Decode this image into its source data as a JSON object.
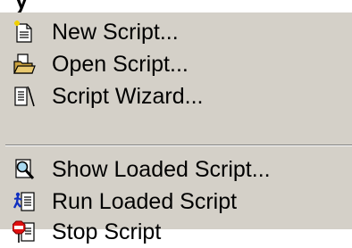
{
  "menu": {
    "items": [
      {
        "label": "New Script...",
        "icon": "new-script-icon"
      },
      {
        "label": "Open Script...",
        "icon": "open-script-icon"
      },
      {
        "label": "Script Wizard...",
        "icon": "script-wizard-icon"
      },
      {
        "label": "Show Loaded Script...",
        "icon": "show-loaded-script-icon"
      },
      {
        "label": "Run Loaded Script",
        "icon": "run-loaded-script-icon"
      },
      {
        "label": "Stop Script",
        "icon": "stop-script-icon"
      }
    ]
  },
  "colors": {
    "menu_background": "#d4d0c8",
    "text": "#000000",
    "separator_dark": "#808080",
    "separator_light": "#ffffff"
  }
}
